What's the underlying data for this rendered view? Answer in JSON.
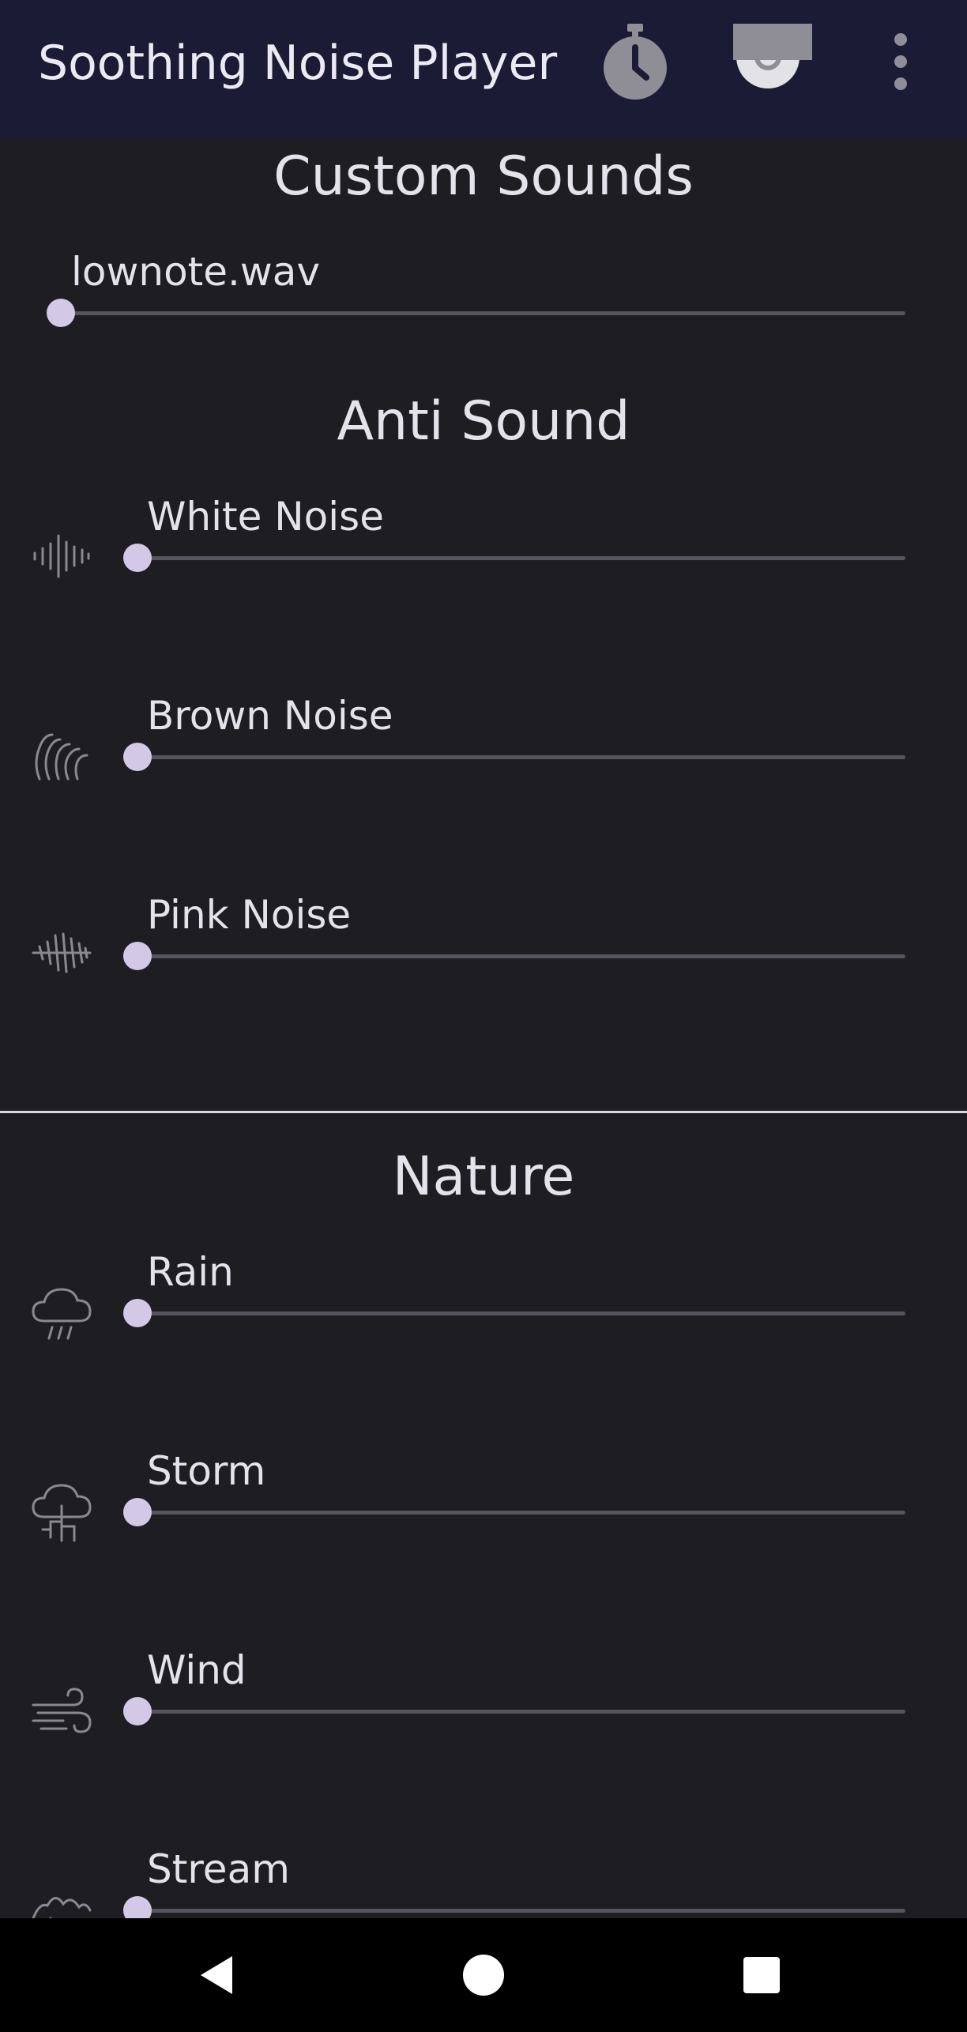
{
  "app": {
    "title": "Soothing Noise Player"
  },
  "toolbar": {
    "icons": [
      "timer-icon",
      "cast-icon",
      "more-options-icon"
    ]
  },
  "sections": {
    "custom": {
      "title": "Custom Sounds",
      "items": [
        {
          "label": "lownote.wav",
          "volume": 0
        }
      ]
    },
    "anti": {
      "title": "Anti Sound",
      "items": [
        {
          "label": "White Noise",
          "icon": "white-noise-icon",
          "volume": 0
        },
        {
          "label": "Brown Noise",
          "icon": "brown-noise-icon",
          "volume": 0
        },
        {
          "label": "Pink Noise",
          "icon": "pink-noise-icon",
          "volume": 0
        }
      ]
    },
    "nature": {
      "title": "Nature",
      "items": [
        {
          "label": "Rain",
          "icon": "rain-icon",
          "volume": 0
        },
        {
          "label": "Storm",
          "icon": "storm-icon",
          "volume": 0
        },
        {
          "label": "Wind",
          "icon": "wind-icon",
          "volume": 0
        },
        {
          "label": "Stream",
          "icon": "stream-icon",
          "volume": 0
        }
      ]
    }
  },
  "navbar": {
    "icons": [
      "back-icon",
      "home-icon",
      "recents-icon"
    ]
  },
  "colors": {
    "appbar": "#1c1b36",
    "background": "#1e1d22",
    "accent": "#d3c9e6",
    "track": "#56545c"
  }
}
